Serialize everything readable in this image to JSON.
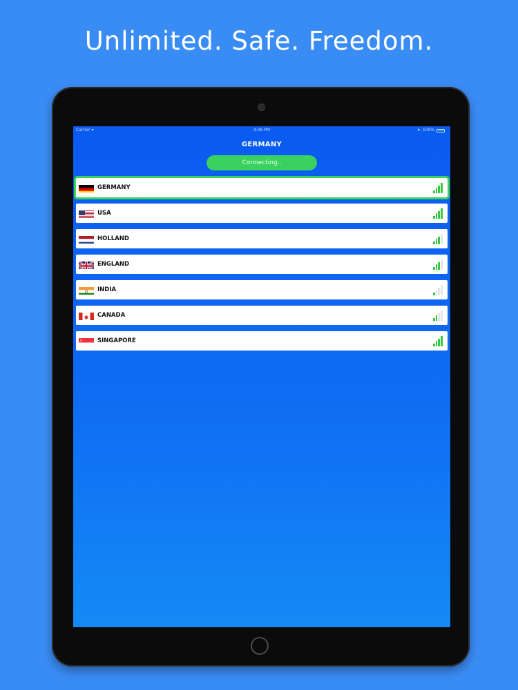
{
  "headline": "Unlimited. Safe. Freedom.",
  "status_bar": {
    "carrier": "Carrier",
    "time": "4:26 PM",
    "battery": "100%"
  },
  "screen_title": "GERMANY",
  "connect_button": "Connecting..",
  "countries": [
    {
      "name": "GERMANY",
      "flag": "germany-flag",
      "signal": 4,
      "selected": true
    },
    {
      "name": "USA",
      "flag": "usa-flag",
      "signal": 4,
      "selected": false
    },
    {
      "name": "HOLLAND",
      "flag": "holland-flag",
      "signal": 3,
      "selected": false
    },
    {
      "name": "ENGLAND",
      "flag": "england-flag",
      "signal": 3,
      "selected": false
    },
    {
      "name": "INDIA",
      "flag": "india-flag",
      "signal": 1,
      "selected": false
    },
    {
      "name": "CANADA",
      "flag": "canada-flag",
      "signal": 2,
      "selected": false
    },
    {
      "name": "SINGAPORE",
      "flag": "singapore-flag",
      "signal": 4,
      "selected": false
    }
  ],
  "colors": {
    "background": "#3a8cf5",
    "accent_green": "#3ad15e",
    "screen_blue": "#0a5bf0"
  }
}
